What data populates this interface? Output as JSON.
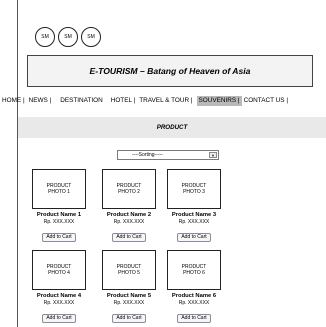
{
  "social": [
    "SM",
    "SM",
    "SM"
  ],
  "banner_title": "E-TOURISM – Batang of Heaven of Asia",
  "nav": [
    {
      "label": "HOME |",
      "active": false
    },
    {
      "label": "NEWS |",
      "active": false
    },
    {
      "label": "DESTINATION",
      "active": false
    },
    {
      "label": "HOTEL |",
      "active": false
    },
    {
      "label": "TRAVEL & TOUR |",
      "active": false
    },
    {
      "label": "SOUVENIRS |",
      "active": true
    },
    {
      "label": "CONTACT US |",
      "active": false
    }
  ],
  "section_title": "PRODUCT",
  "sorting": {
    "selected": "----Sorting-----",
    "caret_icon": "chevron-down-icon"
  },
  "products": [
    {
      "photo": "PRODUCT\nPHOTO 1",
      "name": "Product Name 1",
      "price": "Rp. XXX.XXX",
      "cart": "Add to Cart"
    },
    {
      "photo": "PRODUCT\nPHOTO 2",
      "name": "Product Name 2",
      "price": "Rp. XXX.XXX",
      "cart": "Add to Cart"
    },
    {
      "photo": "PRODUCT\nPHOTO 3",
      "name": "Product Name 3",
      "price": "Rp. XXX.XXX",
      "cart": "Add to Cart"
    },
    {
      "photo": "PRODUCT\nPHOTO 4",
      "name": "Product Name 4",
      "price": "Rp. XXX.XXX",
      "cart": "Add to Cart"
    },
    {
      "photo": "PRODUCT\nPHOTO 5",
      "name": "Product Name 5",
      "price": "Rp. XXX.XXX",
      "cart": "Add to Cart"
    },
    {
      "photo": "PRODUCT\nPHOTO 6",
      "name": "Product Name 6",
      "price": "Rp. XXX.XXX",
      "cart": "Add to Cart"
    }
  ]
}
